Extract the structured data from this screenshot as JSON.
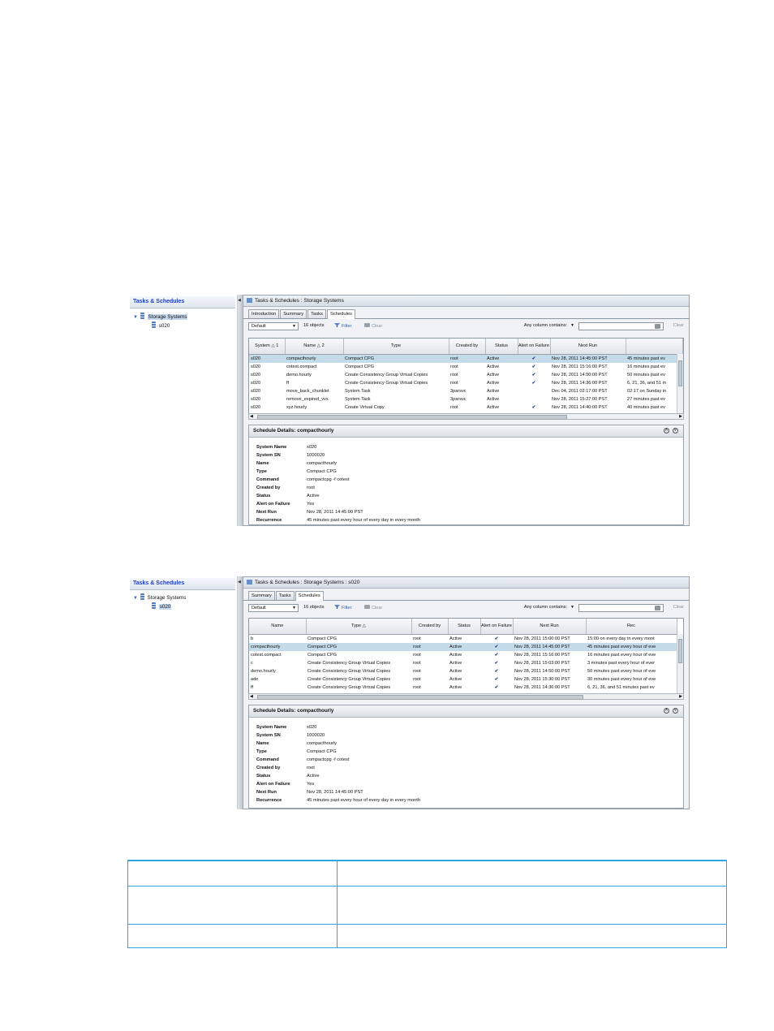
{
  "screenshot1": {
    "nav": {
      "title": "Tasks & Schedules",
      "root": "Storage Systems",
      "child": "s020",
      "selected": "root"
    },
    "header": "Tasks & Schedules : Storage Systems",
    "tabs": [
      "Introduction",
      "Summary",
      "Tasks",
      "Schedules"
    ],
    "active_tab": "Schedules",
    "toolbar": {
      "view": "Default",
      "count": "16 objects",
      "filter": "Filter",
      "clear": "Clear",
      "any_column": "Any column contains:",
      "clear2": "Clear"
    },
    "columns": [
      "System △ 1",
      "Name △ 2",
      "Type",
      "Created by",
      "Status",
      "Alert on Failure",
      "Next Run",
      ""
    ],
    "rows": [
      [
        "s020",
        "compacthourly",
        "Compact CPG",
        "root",
        "Active",
        "✔",
        "Nov 28, 2011 14:45:00 PST",
        "45 minutes past ev"
      ],
      [
        "s020",
        "cotest.compact",
        "Compact CPG",
        "root",
        "Active",
        "✔",
        "Nov 28, 2011 15:16:00 PST",
        "16 minutes past ev"
      ],
      [
        "s020",
        "demo.hourly",
        "Create Consistency Group Virtual Copies",
        "root",
        "Active",
        "✔",
        "Nov 28, 2011 14:50:00 PST",
        "50 minutes past ev"
      ],
      [
        "s020",
        "ff",
        "Create Consistency Group Virtual Copies",
        "root",
        "Active",
        "✔",
        "Nov 28, 2011 14:36:00 PST",
        "6, 21, 36, and 51 m"
      ],
      [
        "s020",
        "move_back_chunklet",
        "System Task",
        "3parsvc",
        "Active",
        "",
        "Dec 04, 2011 02:17:00 PST",
        "02:17 on Sunday in"
      ],
      [
        "s020",
        "remove_expired_vvs",
        "System Task",
        "3parsvc",
        "Active",
        "",
        "Nov 28, 2011 15:27:00 PST",
        "27 minutes past ev"
      ],
      [
        "s020",
        "xyz.hourly",
        "Create Virtual Copy",
        "root",
        "Active",
        "✔",
        "Nov 28, 2011 14:40:00 PST",
        "40 minutes past ev"
      ]
    ],
    "selected_row": 0,
    "details_title": "Schedule Details: compacthourly",
    "details": [
      [
        "System Name",
        "s020"
      ],
      [
        "System SN",
        "1000020"
      ],
      [
        "Name",
        "compacthourly"
      ],
      [
        "Type",
        "Compact CPG"
      ],
      [
        "Command",
        "compactcpg -f cotest"
      ],
      [
        "Created by",
        "root"
      ],
      [
        "Status",
        "Active"
      ],
      [
        "Alert on Failure",
        "Yes"
      ],
      [
        "Next Run",
        "Nov 28, 2011 14:45:00 PST"
      ],
      [
        "Recurrence",
        "45 minutes past every hour of every day in every month"
      ]
    ]
  },
  "screenshot2": {
    "nav": {
      "title": "Tasks & Schedules",
      "root": "Storage Systems",
      "child": "s020",
      "selected": "child"
    },
    "header": "Tasks & Schedules : Storage Systems : s020",
    "tabs": [
      "Summary",
      "Tasks",
      "Schedules"
    ],
    "active_tab": "Schedules",
    "toolbar": {
      "view": "Default",
      "count": "16 objects",
      "filter": "Filter",
      "clear": "Clear",
      "any_column": "Any column contains:",
      "clear2": "Clear"
    },
    "columns": [
      "Name",
      "Type △",
      "Created by",
      "Status",
      "Alert on Failure",
      "Next Run",
      "Rec"
    ],
    "rows": [
      [
        "b",
        "Compact CPG",
        "root",
        "Active",
        "✔",
        "Nov 28, 2011 15:00:00 PST",
        "15:00 on every day in every mont"
      ],
      [
        "compacthourly",
        "Compact CPG",
        "root",
        "Active",
        "✔",
        "Nov 28, 2011 14:45:00 PST",
        "45 minutes past every hour of eve"
      ],
      [
        "cotest.compact",
        "Compact CPG",
        "root",
        "Active",
        "✔",
        "Nov 28, 2011 15:16:00 PST",
        "16 minutes past every hour of eve"
      ],
      [
        "c",
        "Create Consistency Group Virtual Copies",
        "root",
        "Active",
        "✔",
        "Nov 28, 2011 15:03:00 PST",
        "3 minutes past every hour of ever"
      ],
      [
        "demo.hourly",
        "Create Consistency Group Virtual Copies",
        "root",
        "Active",
        "✔",
        "Nov 28, 2011 14:50:00 PST",
        "50 minutes past every hour of eve"
      ],
      [
        "ade",
        "Create Consistency Group Virtual Copies",
        "root",
        "Active",
        "✔",
        "Nov 28, 2011 15:30:00 PST",
        "30 minutes past every hour of eve"
      ],
      [
        "ff",
        "Create Consistency Group Virtual Copies",
        "root",
        "Active",
        "✔",
        "Nov 28, 2011 14:36:00 PST",
        "6, 21, 36, and 51 minutes past ev"
      ]
    ],
    "selected_row": 1,
    "details_title": "Schedule Details: compacthourly",
    "details": [
      [
        "System Name",
        "s020"
      ],
      [
        "System SN",
        "1000020"
      ],
      [
        "Name",
        "compacthourly"
      ],
      [
        "Type",
        "Compact CPG"
      ],
      [
        "Command",
        "compactcpg -f cotest"
      ],
      [
        "Created by",
        "root"
      ],
      [
        "Status",
        "Active"
      ],
      [
        "Alert on Failure",
        "Yes"
      ],
      [
        "Next Run",
        "Nov 28, 2011 14:45:00 PST"
      ],
      [
        "Recurrence",
        "45 minutes past every hour of every day in every month"
      ]
    ]
  },
  "colors": {
    "accent": "#2fa4dd",
    "selection": "#c4dcea",
    "nav_title": "#1f3fbf"
  }
}
